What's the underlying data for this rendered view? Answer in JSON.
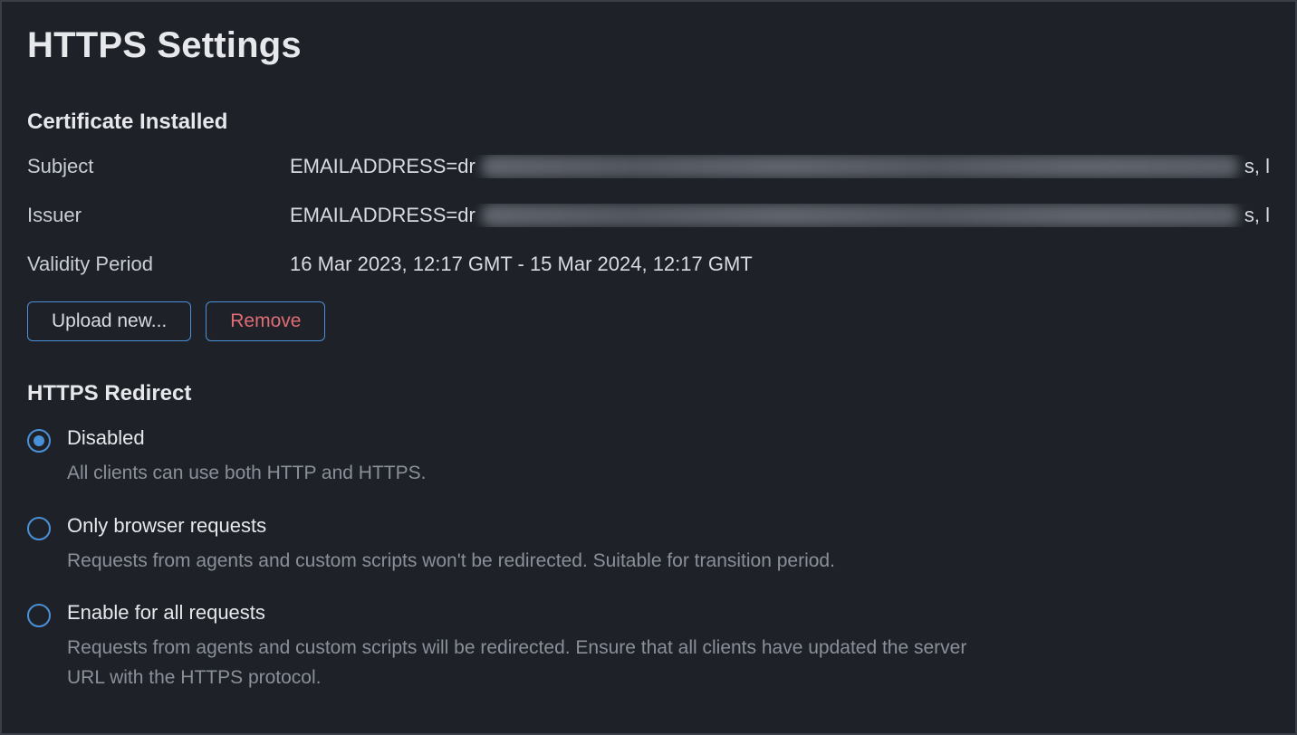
{
  "page": {
    "title": "HTTPS Settings"
  },
  "certificate": {
    "section_title": "Certificate Installed",
    "rows": {
      "subject_label": "Subject",
      "subject_prefix": "EMAILADDRESS=dr",
      "subject_suffix": "s, l",
      "issuer_label": "Issuer",
      "issuer_prefix": "EMAILADDRESS=dr",
      "issuer_suffix": "s, l",
      "validity_label": "Validity Period",
      "validity_value": "16 Mar 2023, 12:17 GMT - 15 Mar 2024, 12:17 GMT"
    },
    "buttons": {
      "upload": "Upload new...",
      "remove": "Remove"
    }
  },
  "redirect": {
    "section_title": "HTTPS Redirect",
    "options": [
      {
        "label": "Disabled",
        "desc": "All clients can use both HTTP and HTTPS.",
        "selected": true
      },
      {
        "label": "Only browser requests",
        "desc": "Requests from agents and custom scripts won't be redirected. Suitable for transition period.",
        "selected": false
      },
      {
        "label": "Enable for all requests",
        "desc": "Requests from agents and custom scripts will be redirected. Ensure that all clients have updated the server URL with the HTTPS protocol.",
        "selected": false
      }
    ]
  }
}
